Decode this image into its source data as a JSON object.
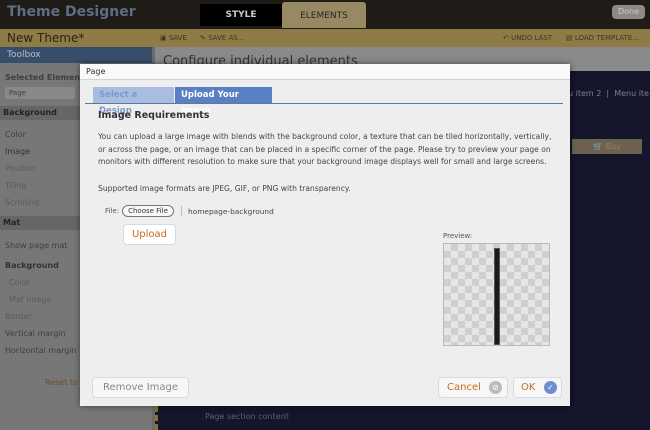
{
  "app": {
    "title": "Theme Designer",
    "tabs": [
      "STYLE",
      "ELEMENTS"
    ],
    "done": "Done"
  },
  "toolbar": {
    "theme_name": "New Theme*",
    "save": "SAVE",
    "save_as": "SAVE AS...",
    "undo": "UNDO LAST",
    "load": "LOAD TEMPLATE..."
  },
  "sidebar": {
    "title": "Toolbox",
    "selected_label": "Selected Element:",
    "selected_value": "Page",
    "background_header": "Background",
    "items1": [
      "Color",
      "Image",
      "Position",
      "Tiling",
      "Scrolling"
    ],
    "mat_header": "Mat",
    "items2": [
      "Show page mat",
      "Background",
      "Color",
      "Mat image",
      "Border",
      "Vertical margin",
      "Horizontal margin"
    ],
    "reset": "Reset to D"
  },
  "main": {
    "title": "Configure individual elements",
    "menu": "u item 2  |  Menu ite",
    "buy": "Buy",
    "section_content": "Page section content"
  },
  "dialog": {
    "title": "Page",
    "tabs": [
      "Select a Design",
      "Upload Your Image"
    ],
    "heading": "Image Requirements",
    "text": "You can upload a large image with blends with the background color, a texture that can be tiled horizontally, vertically, or across the page, or an image that can be placed in a specific corner of the page. Please try to preview your page on monitors with different resolution to make sure that your background image displays well for small and large screens.",
    "formats": "Supported image formats are JPEG, GIF, or PNG with transparency.",
    "file_label": "File:",
    "choose_file": "Choose File",
    "file_name": "homepage-background",
    "upload": "Upload",
    "preview_label": "Preview:",
    "remove": "Remove Image",
    "cancel": "Cancel",
    "ok": "OK"
  }
}
